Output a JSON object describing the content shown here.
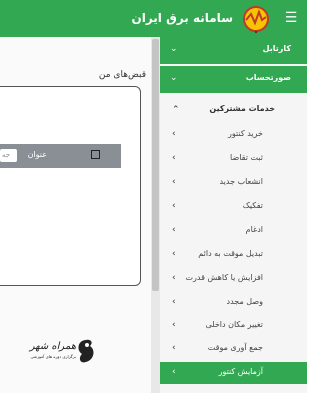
{
  "header": {
    "title": "سامانه برق ایران",
    "menu_icon": "hamburger-icon",
    "logo_icon": "power-logo-icon",
    "color": "#33a852"
  },
  "main": {
    "card_title": "قبض‌های من",
    "table": {
      "column_label": "عنوان",
      "input_value": "جه"
    },
    "watermark": {
      "title": "همراه شهر",
      "subtitle": "برگزاری دوره های آموزشی"
    }
  },
  "sidebar": {
    "sections": [
      {
        "label": "کارتابل",
        "icon": "chevron-down-icon"
      },
      {
        "label": "صورتحساب",
        "icon": "chevron-down-icon"
      }
    ],
    "subsection": {
      "label": "خدمات مشترکین",
      "icon": "chevron-up-icon"
    },
    "items": [
      {
        "label": "خرید کنتور"
      },
      {
        "label": "ثبت تقاضا"
      },
      {
        "label": "انشعاب جدید"
      },
      {
        "label": "تفکیک"
      },
      {
        "label": "ادغام"
      },
      {
        "label": "تبدیل موقت به دائم"
      },
      {
        "label": "افزایش یا کاهش قدرت"
      },
      {
        "label": "وصل مجدد"
      },
      {
        "label": "تغییر مکان داخلی"
      },
      {
        "label": "جمع آوری موقت"
      },
      {
        "label": "آزمایش کنتور"
      }
    ],
    "active_item": "آزمایش کنتور"
  }
}
